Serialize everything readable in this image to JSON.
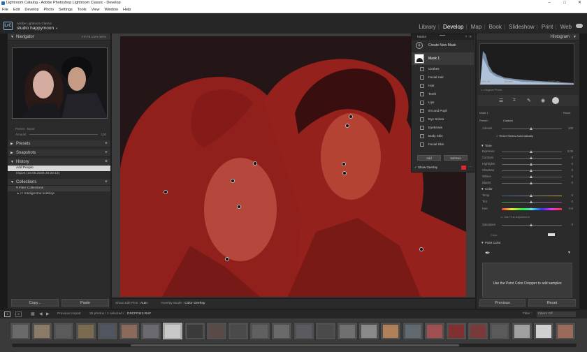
{
  "window": {
    "title": "Lightroom Catalog - Adobe Photoshop Lightroom Classic - Develop",
    "controls": [
      "–",
      "□",
      "✕"
    ]
  },
  "menu": [
    "File",
    "Edit",
    "Develop",
    "Photo",
    "Settings",
    "Tools",
    "View",
    "Window",
    "Help"
  ],
  "identity": {
    "logo": "LrC",
    "subtitle": "Adobe Lightroom Classic",
    "studio": "studio happymoon",
    "caret": "▼"
  },
  "modules": {
    "items": [
      "Library",
      "Develop",
      "Map",
      "Book",
      "Slideshow",
      "Print",
      "Web"
    ],
    "active": "Develop"
  },
  "left": {
    "navigator": {
      "title": "Navigator",
      "zoom": "FIT  Fill  100%  300%"
    },
    "preset_label": "Preset : None",
    "amount_label": "Amount",
    "amount_value": "100",
    "panels": {
      "presets": "Presets",
      "snapshots": "Snapshots",
      "history": "History",
      "collections": "Collections"
    },
    "history_items": [
      "Add People",
      "Import (19.05.2025 20:30:13)"
    ],
    "collections_items": [
      "Filter Collections",
      "Inteligentne kolekcje"
    ],
    "copy": "Copy...",
    "paste": "Paste"
  },
  "toolbar": {
    "show_edit_pins_label": "Show Edit Pins :",
    "show_edit_pins_value": "Auto",
    "overlay_mode_label": "Overlay Mode :",
    "overlay_mode_value": "Color Overlay"
  },
  "masks": {
    "title": "Masks",
    "create": "Create New Mask",
    "mask1": "Mask 1",
    "parts": [
      "Clothes",
      "Facial Hair",
      "Hair",
      "Teeth",
      "Lips",
      "Iris and Pupil",
      "Eye Sclera",
      "Eyebrows",
      "Body Skin",
      "Facial Skin"
    ],
    "add": "Add",
    "subtract": "Subtract",
    "show_overlay": "Show Overlay",
    "overlay_color": "#e2232a"
  },
  "right": {
    "histogram": "Histogram",
    "hist_info": [
      "ISO 40",
      "26 mm",
      "f / 4.0",
      "1/100 sec"
    ],
    "original_photo": "Original Photo",
    "mask_label": "Mask 1",
    "reset_label": "Reset",
    "preset": "Preset :",
    "preset_value": "Custom",
    "amount": "Amount",
    "amount_value": "100",
    "reset_sliders": "Reset Sliders Automatically",
    "tone": "Tone",
    "tone_sliders": [
      {
        "label": "Exposure",
        "value": "0.00"
      },
      {
        "label": "Contrast",
        "value": "0"
      },
      {
        "label": "Highlights",
        "value": "0"
      },
      {
        "label": "Shadows",
        "value": "0"
      },
      {
        "label": "Whites",
        "value": "0"
      },
      {
        "label": "Blacks",
        "value": "0"
      }
    ],
    "color": "Color",
    "color_sliders": [
      {
        "label": "Temp",
        "value": "0"
      },
      {
        "label": "Tint",
        "value": "0"
      }
    ],
    "hue_label": "Hue",
    "hue_value": "0.0",
    "use_fine": "Use Fine Adjustment",
    "saturation_label": "Saturation",
    "saturation_value": "0",
    "color_label": "Color",
    "point_color": "Point Color",
    "point_color_hint": "Use the Point Color Dropper to add samples",
    "previous": "Previous",
    "reset": "Reset"
  },
  "filmstrip_bar": {
    "pages": [
      "1",
      "2"
    ],
    "source": "Previous Import",
    "count": "35 photos / 1 selected /",
    "filename": "DSCF0112.RAF",
    "filter_label": "Filter :",
    "filter_value": "Filters Off"
  },
  "filmstrip": {
    "selected_index": 7,
    "count": 26
  }
}
